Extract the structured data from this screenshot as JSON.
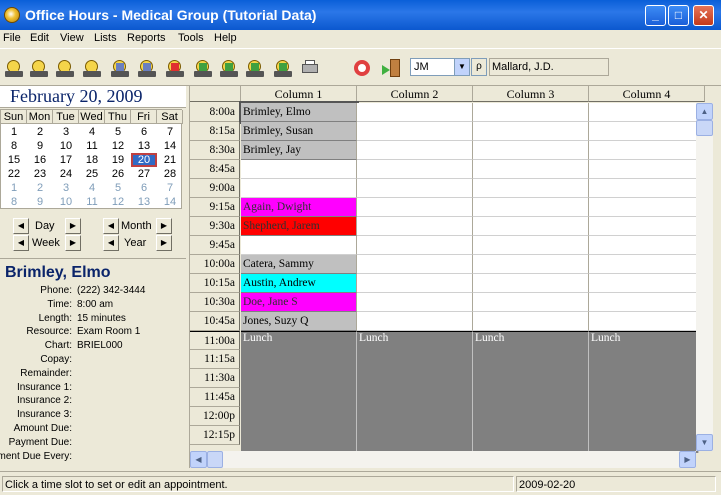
{
  "window": {
    "title": "Office Hours - Medical Group (Tutorial Data)",
    "minimize": "_",
    "maximize": "□",
    "close": "✕"
  },
  "menu": [
    "File",
    "Edit",
    "View",
    "Lists",
    "Reports",
    "Tools",
    "Help"
  ],
  "toolbar": {
    "icons": [
      "alarm-clock-icon",
      "alarm-clock-icon",
      "alarm-clock-icon",
      "alarm-clock-icon",
      "people-icon",
      "people-icon",
      "medical-kit-icon",
      "transfer-icon",
      "transfer-icon",
      "transfer-icon",
      "transfer-icon",
      "print-icon",
      "help-icon",
      "exit-door-icon"
    ],
    "user_select": "JM",
    "provider": "Mallard, J.D."
  },
  "calendar": {
    "title": "February 20, 2009",
    "weekdays": [
      "Sun",
      "Mon",
      "Tue",
      "Wed",
      "Thu",
      "Fri",
      "Sat"
    ],
    "weeks": [
      [
        [
          "1",
          0
        ],
        [
          "2",
          0
        ],
        [
          "3",
          0
        ],
        [
          "4",
          0
        ],
        [
          "5",
          0
        ],
        [
          "6",
          0
        ],
        [
          "7",
          0
        ]
      ],
      [
        [
          "8",
          0
        ],
        [
          "9",
          0
        ],
        [
          "10",
          0
        ],
        [
          "11",
          0
        ],
        [
          "12",
          0
        ],
        [
          "13",
          0
        ],
        [
          "14",
          0
        ]
      ],
      [
        [
          "15",
          0
        ],
        [
          "16",
          0
        ],
        [
          "17",
          0
        ],
        [
          "18",
          0
        ],
        [
          "19",
          0
        ],
        [
          "20",
          2
        ],
        [
          "21",
          0
        ]
      ],
      [
        [
          "22",
          0
        ],
        [
          "23",
          0
        ],
        [
          "24",
          0
        ],
        [
          "25",
          0
        ],
        [
          "26",
          0
        ],
        [
          "27",
          0
        ],
        [
          "28",
          0
        ]
      ],
      [
        [
          "1",
          1
        ],
        [
          "2",
          1
        ],
        [
          "3",
          1
        ],
        [
          "4",
          1
        ],
        [
          "5",
          1
        ],
        [
          "6",
          1
        ],
        [
          "7",
          1
        ]
      ],
      [
        [
          "8",
          1
        ],
        [
          "9",
          1
        ],
        [
          "10",
          1
        ],
        [
          "11",
          1
        ],
        [
          "12",
          1
        ],
        [
          "13",
          1
        ],
        [
          "14",
          1
        ]
      ]
    ]
  },
  "nav": {
    "day": "Day",
    "week": "Week",
    "month": "Month",
    "year": "Year",
    "prev": "◀",
    "next": "▶"
  },
  "details": {
    "name": "Brimley, Elmo",
    "fields": [
      {
        "label": "Phone:",
        "value": "(222) 342-3444"
      },
      {
        "label": "Time:",
        "value": "8:00 am"
      },
      {
        "label": "Length:",
        "value": "15 minutes"
      },
      {
        "label": "Resource:",
        "value": "Exam Room 1"
      },
      {
        "label": "Chart:",
        "value": "BRIEL000"
      },
      {
        "label": "Copay:",
        "value": ""
      },
      {
        "label": "Remainder:",
        "value": ""
      },
      {
        "label": "Insurance 1:",
        "value": ""
      },
      {
        "label": "Insurance 2:",
        "value": ""
      },
      {
        "label": "Insurance 3:",
        "value": ""
      },
      {
        "label": "Amount Due:",
        "value": ""
      },
      {
        "label": "Payment Due:",
        "value": ""
      },
      {
        "label": "Payment Due Every:",
        "value": ""
      }
    ]
  },
  "schedule": {
    "columns": [
      "Column 1",
      "Column 2",
      "Column 3",
      "Column 4"
    ],
    "times": [
      "8:00a",
      "8:15a",
      "8:30a",
      "8:45a",
      "9:00a",
      "9:15a",
      "9:30a",
      "9:45a",
      "10:00a",
      "10:15a",
      "10:30a",
      "10:45a",
      "11:00a",
      "11:15a",
      "11:30a",
      "11:45a",
      "12:00p",
      "12:15p"
    ],
    "appointments": [
      {
        "row": 0,
        "name": "Brimley, Elmo",
        "color": "#c0c0c0",
        "selected": true
      },
      {
        "row": 1,
        "name": "Brimley, Susan",
        "color": "#c0c0c0"
      },
      {
        "row": 2,
        "name": "Brimley, Jay",
        "color": "#c0c0c0"
      },
      {
        "row": 5,
        "name": "Again, Dwight",
        "color": "#ff00ff"
      },
      {
        "row": 6,
        "name": "Shepherd, Jarem",
        "color": "#ff0000"
      },
      {
        "row": 8,
        "name": "Catera, Sammy",
        "color": "#c0c0c0"
      },
      {
        "row": 9,
        "name": "Austin, Andrew",
        "color": "#00ffff"
      },
      {
        "row": 10,
        "name": "Doe, Jane S",
        "color": "#ff00ff"
      },
      {
        "row": 11,
        "name": "Jones, Suzy Q",
        "color": "#c0c0c0"
      }
    ],
    "lunch_label": "Lunch",
    "lunch_start_row": 12
  },
  "scroll": {
    "up": "▲",
    "down": "▼",
    "left": "◀",
    "right": "▶"
  },
  "status": {
    "message": "Click a time slot to set or edit an appointment.",
    "date": "2009-02-20"
  }
}
